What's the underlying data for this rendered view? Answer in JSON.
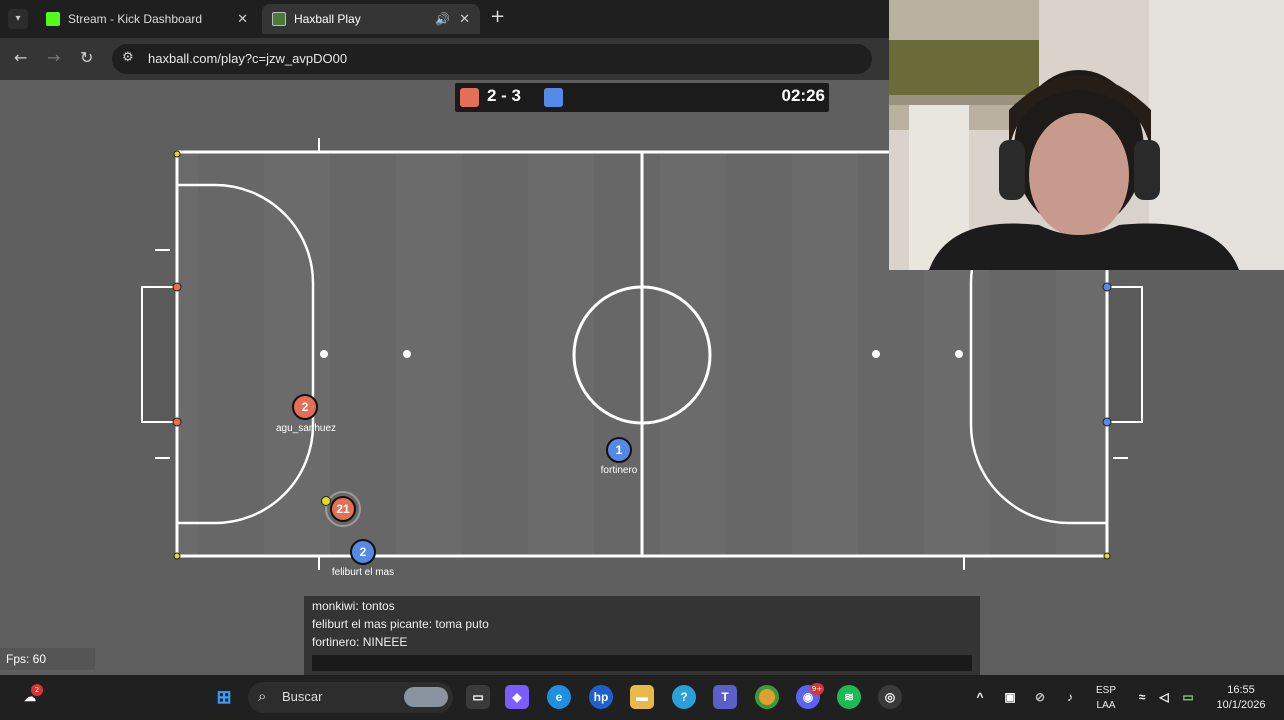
{
  "browser": {
    "tabs": [
      {
        "title": "Stream - Kick Dashboard",
        "favicon": "kick-icon",
        "color": "#53fc18"
      },
      {
        "title": "Haxball Play",
        "favicon": "haxball-icon",
        "color": "#4a7a3a"
      }
    ],
    "url": "haxball.com/play?c=jzw_avpDO00"
  },
  "game": {
    "score": "2 - 3",
    "timer": "02:26",
    "red_color": "#e56e56",
    "blue_color": "#5689e5",
    "players": [
      {
        "number": "2",
        "team": "red",
        "name": "agu_sanhuez"
      },
      {
        "number": "21",
        "team": "red",
        "name": ""
      },
      {
        "number": "1",
        "team": "blue",
        "name": "fortinero"
      },
      {
        "number": "2",
        "team": "blue",
        "name": "feliburt el mas"
      }
    ],
    "fps": "Fps: 60"
  },
  "chat": {
    "messages": [
      "monkiwi: tontos",
      "feliburt el mas picante: toma puto",
      "fortinero: NINEEE"
    ]
  },
  "taskbar": {
    "search_placeholder": "Buscar",
    "lang_top": "ESP",
    "lang_bottom": "LAA",
    "time": "16:55",
    "date": "10/1/2026",
    "weather_badge": "2",
    "discord_badge": "9+"
  }
}
